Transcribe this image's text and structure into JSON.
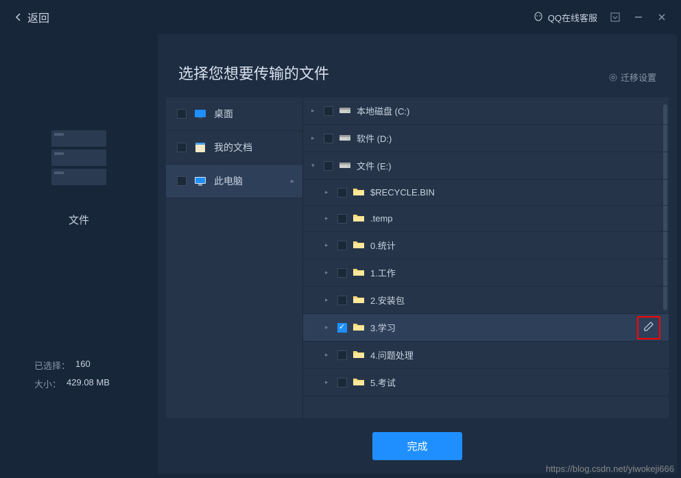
{
  "titlebar": {
    "back_label": "返回",
    "qq_service_label": "QQ在线客服"
  },
  "left": {
    "file_label": "文件",
    "selected_label": "已选择：",
    "selected_value": "160",
    "size_label": "大小：",
    "size_value": "429.08 MB"
  },
  "panel": {
    "title": "选择您想要传输的文件",
    "settings_label": "迁移设置",
    "done_label": "完成"
  },
  "categories": [
    {
      "label": "桌面",
      "active": false
    },
    {
      "label": "我的文档",
      "active": false
    },
    {
      "label": "此电脑",
      "active": true
    }
  ],
  "tree": [
    {
      "label": "本地磁盘 (C:)",
      "type": "drive",
      "depth": 0,
      "expanded": false,
      "checked": false
    },
    {
      "label": "软件 (D:)",
      "type": "drive",
      "depth": 0,
      "expanded": false,
      "checked": false
    },
    {
      "label": "文件 (E:)",
      "type": "drive",
      "depth": 0,
      "expanded": true,
      "checked": false
    },
    {
      "label": "$RECYCLE.BIN",
      "type": "folder",
      "depth": 1,
      "expanded": false,
      "checked": false
    },
    {
      "label": ".temp",
      "type": "folder",
      "depth": 1,
      "expanded": false,
      "checked": false
    },
    {
      "label": "0.统计",
      "type": "folder",
      "depth": 1,
      "expanded": false,
      "checked": false
    },
    {
      "label": "1.工作",
      "type": "folder",
      "depth": 1,
      "expanded": false,
      "checked": false
    },
    {
      "label": "2.安装包",
      "type": "folder",
      "depth": 1,
      "expanded": false,
      "checked": false
    },
    {
      "label": "3.学习",
      "type": "folder",
      "depth": 1,
      "expanded": false,
      "checked": true,
      "selected": true,
      "editable": true
    },
    {
      "label": "4.问题处理",
      "type": "folder",
      "depth": 1,
      "expanded": false,
      "checked": false
    },
    {
      "label": "5.考试",
      "type": "folder",
      "depth": 1,
      "expanded": false,
      "checked": false
    }
  ],
  "watermark": "https://blog.csdn.net/yiwokeji666"
}
